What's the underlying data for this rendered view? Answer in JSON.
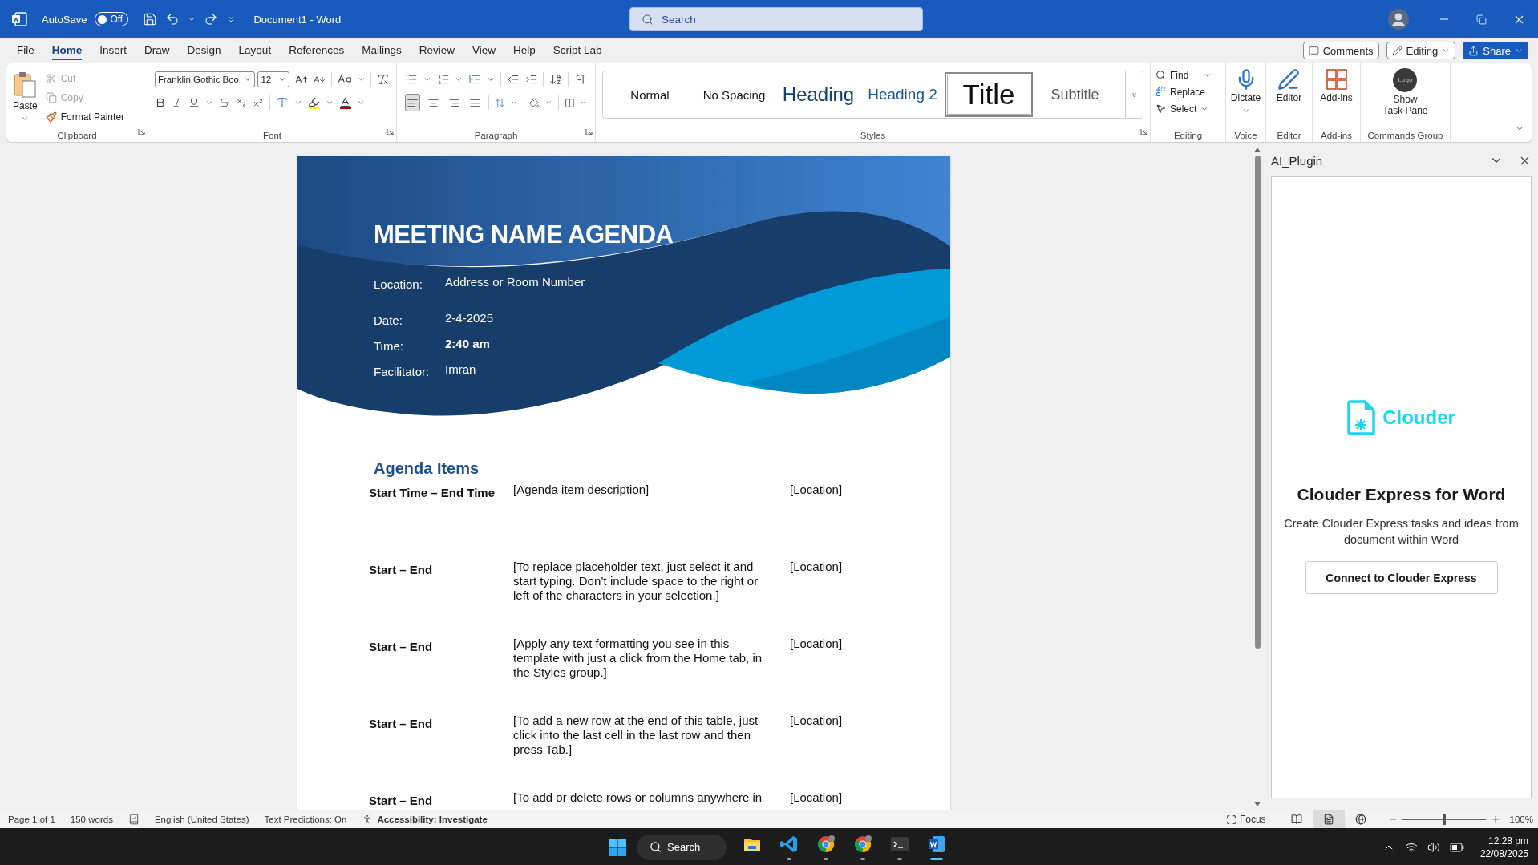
{
  "title_bar": {
    "autosave_label": "AutoSave",
    "autosave": {
      "on": false,
      "label": "Off"
    },
    "document_title": "Document1  -  Word",
    "search_placeholder": "Search"
  },
  "menu_tabs": [
    {
      "label": "File",
      "selected": false
    },
    {
      "label": "Home",
      "selected": true
    },
    {
      "label": "Insert",
      "selected": false
    },
    {
      "label": "Draw",
      "selected": false
    },
    {
      "label": "Design",
      "selected": false
    },
    {
      "label": "Layout",
      "selected": false
    },
    {
      "label": "References",
      "selected": false
    },
    {
      "label": "Mailings",
      "selected": false
    },
    {
      "label": "Review",
      "selected": false
    },
    {
      "label": "View",
      "selected": false
    },
    {
      "label": "Help",
      "selected": false
    },
    {
      "label": "Script Lab",
      "selected": false
    }
  ],
  "top_buttons": [
    {
      "kind": "comments",
      "label": "Comments"
    },
    {
      "kind": "editing",
      "label": "Editing"
    },
    {
      "kind": "share",
      "label": "Share"
    }
  ],
  "ribbon": {
    "clipboard": {
      "label": "Clipboard",
      "paste": "Paste",
      "cut": {
        "label": "Cut",
        "disabled": true
      },
      "copy": {
        "label": "Copy",
        "disabled": true
      },
      "format_painter": {
        "label": "Format Painter",
        "disabled": false
      }
    },
    "font": {
      "label": "Font",
      "font_name": "Franklin Gothic Boo",
      "font_size": "12"
    },
    "paragraph": {
      "label": "Paragraph",
      "alignments": [
        {
          "kind": "left",
          "selected": true
        },
        {
          "kind": "center",
          "selected": false
        },
        {
          "kind": "right",
          "selected": false
        },
        {
          "kind": "justify",
          "selected": false
        }
      ]
    },
    "styles": {
      "label": "Styles",
      "items": [
        {
          "kind": "normal",
          "label": "Normal",
          "selected": false
        },
        {
          "kind": "nospacing",
          "label": "No Spacing",
          "selected": false
        },
        {
          "kind": "heading",
          "label": "Heading",
          "selected": false
        },
        {
          "kind": "heading2",
          "label": "Heading 2",
          "selected": false
        },
        {
          "kind": "title",
          "label": "Title",
          "selected": true
        },
        {
          "kind": "subtitle",
          "label": "Subtitle",
          "selected": false
        }
      ]
    },
    "editing": {
      "label": "Editing",
      "items": [
        {
          "kind": "find",
          "label": "Find"
        },
        {
          "kind": "replace",
          "label": "Replace"
        },
        {
          "kind": "select",
          "label": "Select"
        }
      ]
    },
    "voice": {
      "label": "Voice",
      "button": "Dictate"
    },
    "editor": {
      "label": "Editor",
      "button": "Editor"
    },
    "addins": {
      "label": "Add-ins",
      "button": "Add-ins"
    },
    "commands": {
      "label": "Commands Group",
      "logo": "Logo",
      "button_lines": [
        "Show",
        "Task Pane"
      ]
    }
  },
  "document": {
    "title": "MEETING NAME AGENDA",
    "fields": [
      {
        "label": "Location:",
        "value": "Address or Room Number",
        "bold": false
      },
      {
        "label": "Date:",
        "value": "2-4-2025",
        "bold": false
      },
      {
        "label": "Time:",
        "value": "2:40 am",
        "bold": true
      },
      {
        "label": "Facilitator:",
        "value": "Imran",
        "bold": false
      }
    ],
    "agenda_heading": "Agenda Items",
    "agenda_rows": [
      {
        "time": "Start Time – End Time",
        "description": "[Agenda item description]",
        "location": "[Location]"
      },
      {
        "time": "Start – End",
        "description": "[To replace placeholder text, just select it and start typing. Don’t include space to the right or left of the characters in your selection.]",
        "location": "[Location]"
      },
      {
        "time": "Start – End",
        "description": "[Apply any text formatting you see in this template with just a click from the Home tab, in the Styles group.]",
        "location": "[Location]"
      },
      {
        "time": "Start – End",
        "description": "[To add a new row at the end of this table, just click into the last cell in the last row and then press Tab.]",
        "location": "[Location]"
      },
      {
        "time": "Start – End",
        "description": "[To add or delete rows or columns anywhere in",
        "location": "[Location]"
      }
    ]
  },
  "task_pane": {
    "title": "AI_Plugin",
    "brand": "Clouder",
    "heading": "Clouder Express for Word",
    "description": "Create Clouder Express tasks and ideas from document within Word",
    "button": "Connect to Clouder Express"
  },
  "status_bar": {
    "page": "Page 1 of 1",
    "words": "150 words",
    "language": "English (United States)",
    "predictions": "Text Predictions: On",
    "accessibility": "Accessibility: Investigate",
    "focus": "Focus",
    "views": [
      {
        "kind": "read",
        "selected": false
      },
      {
        "kind": "print",
        "selected": true
      },
      {
        "kind": "web",
        "selected": false
      }
    ],
    "zoom": {
      "level": 0.5,
      "label": "100%"
    }
  },
  "taskbar": {
    "search": "Search",
    "apps": [
      {
        "kind": "explorer",
        "running": false,
        "selected": false
      },
      {
        "kind": "vscode",
        "running": true,
        "selected": false
      },
      {
        "kind": "chrome",
        "running": true,
        "selected": false
      },
      {
        "kind": "chrome",
        "running": true,
        "selected": false
      },
      {
        "kind": "terminal",
        "running": true,
        "selected": false
      },
      {
        "kind": "word",
        "running": true,
        "selected": true
      }
    ],
    "clock": {
      "time": "12:28 pm",
      "date": "22/08/2025"
    }
  }
}
